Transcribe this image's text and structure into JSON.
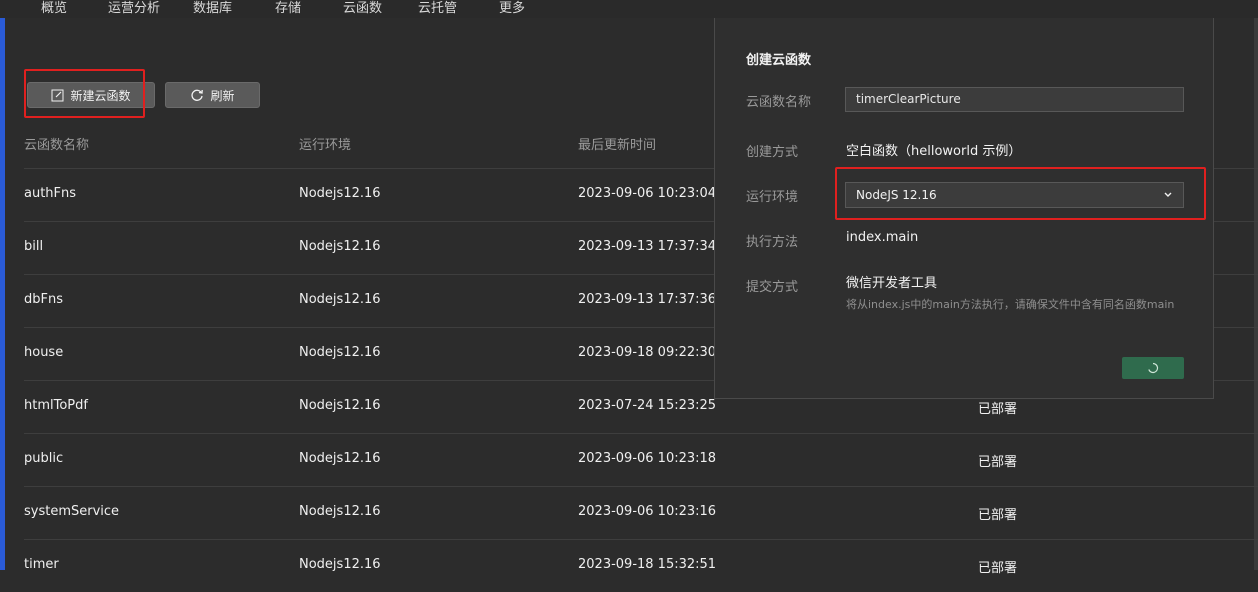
{
  "nav": {
    "items": [
      "概览",
      "运营分析",
      "数据库",
      "存储",
      "云函数",
      "云托管",
      "更多"
    ]
  },
  "toolbar": {
    "new_label": "新建云函数",
    "refresh_label": "刷新"
  },
  "table": {
    "headers": [
      "云函数名称",
      "运行环境",
      "最后更新时间"
    ],
    "rows": [
      {
        "name": "authFns",
        "env": "Nodejs12.16",
        "updated": "2023-09-06 10:23:04",
        "status": ""
      },
      {
        "name": "bill",
        "env": "Nodejs12.16",
        "updated": "2023-09-13 17:37:34",
        "status": ""
      },
      {
        "name": "dbFns",
        "env": "Nodejs12.16",
        "updated": "2023-09-13 17:37:36",
        "status": ""
      },
      {
        "name": "house",
        "env": "Nodejs12.16",
        "updated": "2023-09-18 09:22:30",
        "status": ""
      },
      {
        "name": "htmlToPdf",
        "env": "Nodejs12.16",
        "updated": "2023-07-24 15:23:25",
        "status": "已部署"
      },
      {
        "name": "public",
        "env": "Nodejs12.16",
        "updated": "2023-09-06 10:23:18",
        "status": "已部署"
      },
      {
        "name": "systemService",
        "env": "Nodejs12.16",
        "updated": "2023-09-06 10:23:16",
        "status": "已部署"
      },
      {
        "name": "timer",
        "env": "Nodejs12.16",
        "updated": "2023-09-18 15:32:51",
        "status": "已部署"
      }
    ]
  },
  "panel": {
    "title": "创建云函数",
    "name_label": "云函数名称",
    "name_value": "timerClearPicture",
    "method_label": "创建方式",
    "method_value": "空白函数（helloworld 示例）",
    "runtime_label": "运行环境",
    "runtime_value": "NodeJS 12.16",
    "exec_label": "执行方法",
    "exec_value": "index.main",
    "submit_label": "提交方式",
    "submit_value": "微信开发者工具",
    "submit_hint": "将从index.js中的main方法执行，请确保文件中含有同名函数main"
  },
  "icons": {
    "new": "edit-icon",
    "refresh": "refresh-icon",
    "select": "chevron-down-icon",
    "loading": "loading-spinner-icon"
  },
  "colors": {
    "highlight": "#e0201f",
    "confirm_button": "#2f6b4d"
  }
}
